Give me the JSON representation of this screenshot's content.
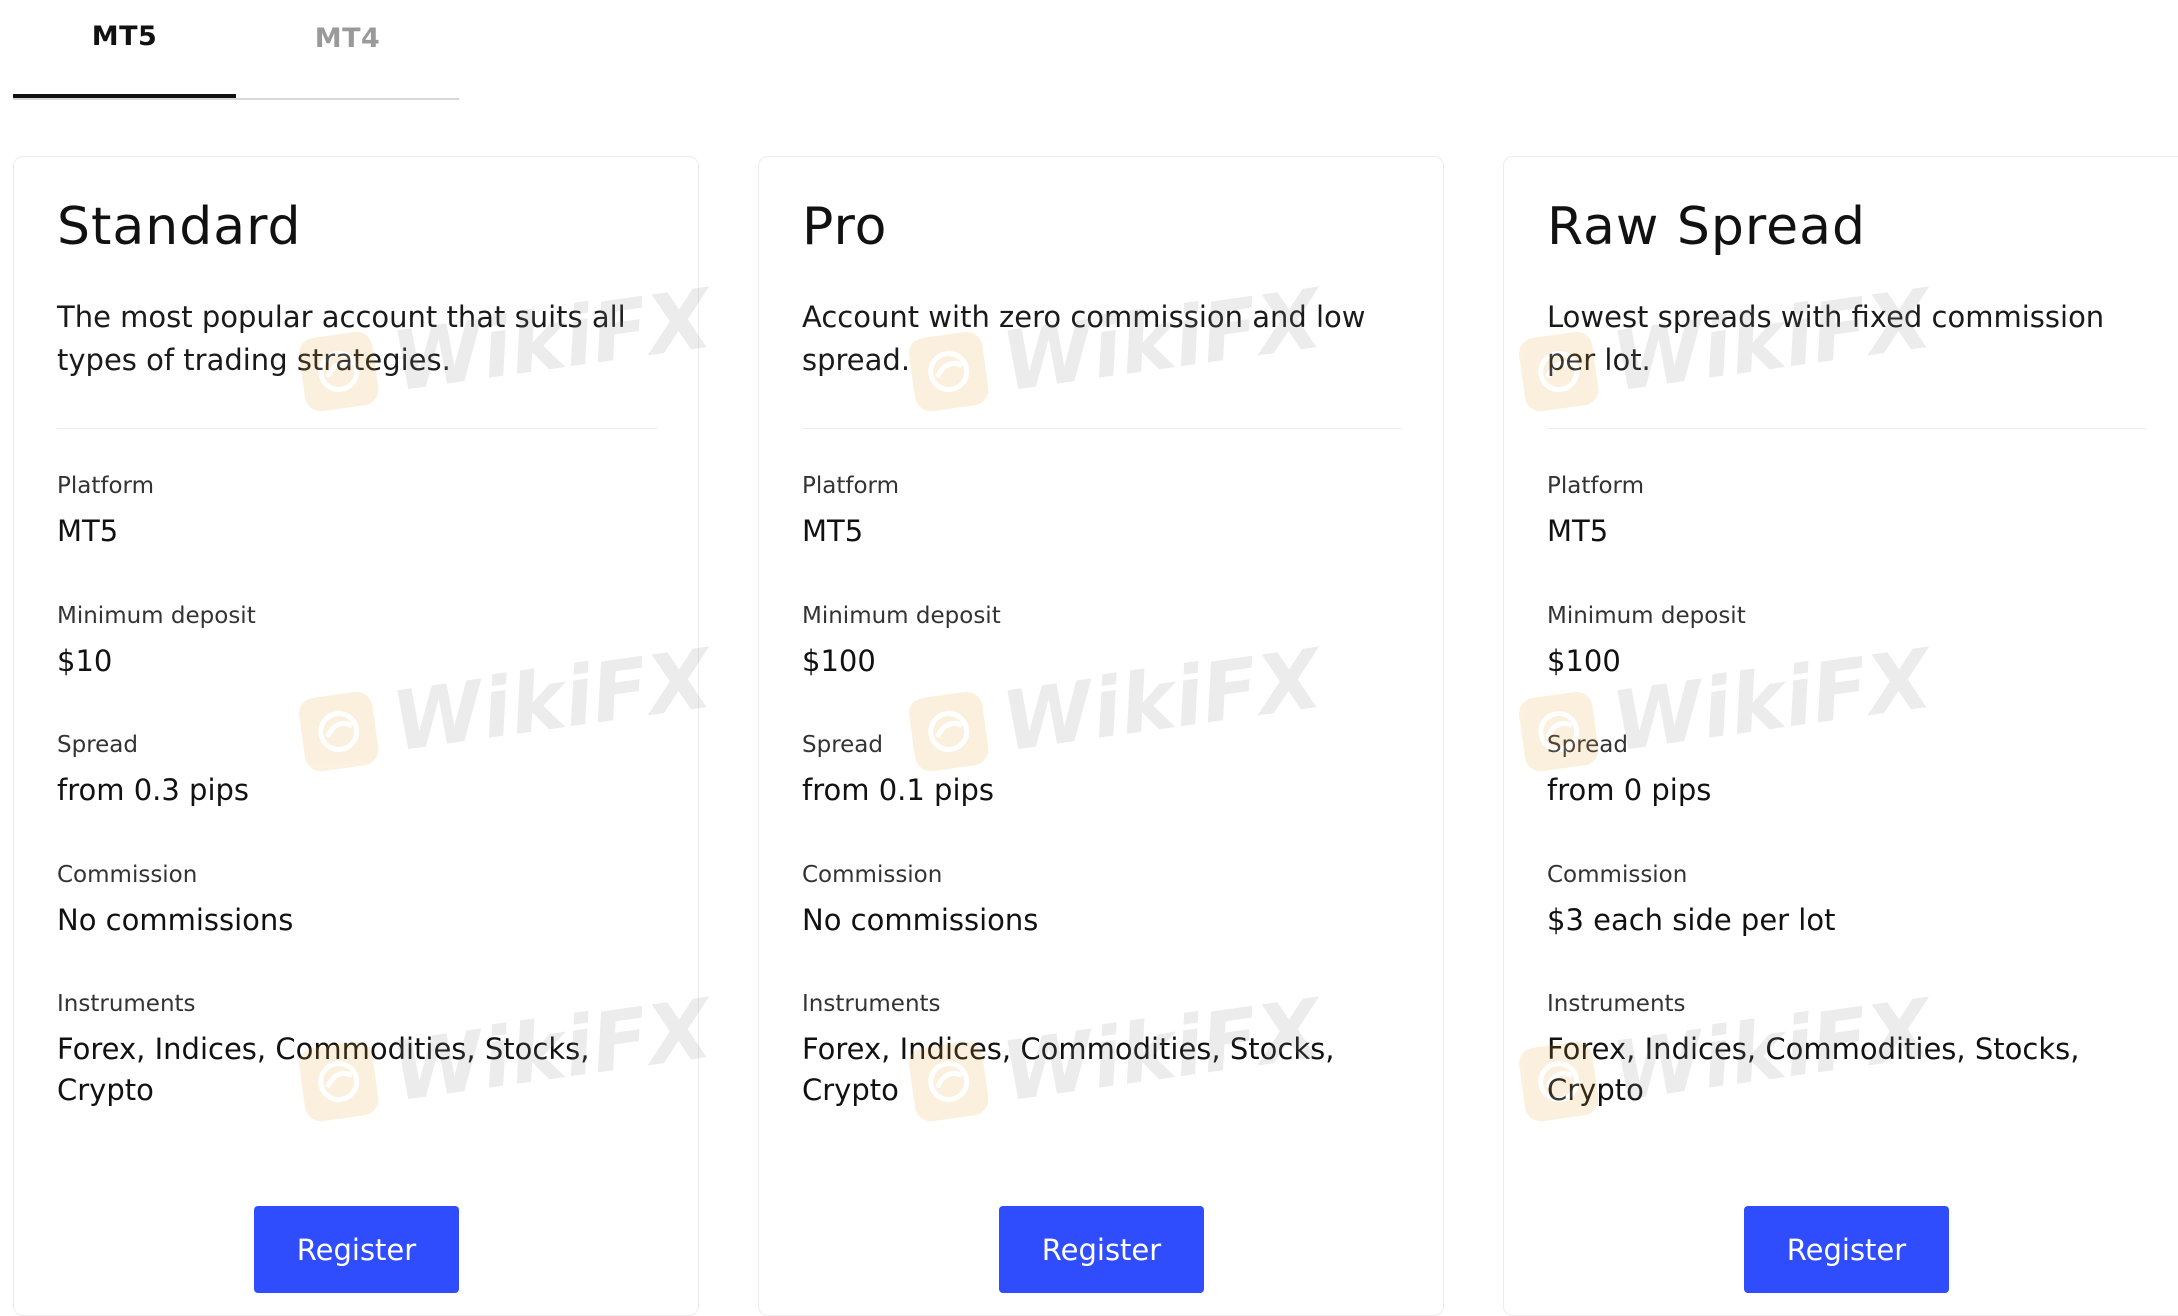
{
  "tabs": [
    {
      "label": "MT5",
      "active": true
    },
    {
      "label": "MT4",
      "active": false
    }
  ],
  "watermark_text": "WikiFX",
  "colors": {
    "accent": "#2f4dfc",
    "watermark_logo": "#e7a634"
  },
  "icons": {
    "watermark_logo": "wikifx-logo-icon"
  },
  "labels": {
    "platform": "Platform",
    "min_deposit": "Minimum deposit",
    "spread": "Spread",
    "commission": "Commission",
    "instruments": "Instruments"
  },
  "cards": [
    {
      "title": "Standard",
      "description": "The most popular account that suits all types of trading strategies.",
      "platform": "MT5",
      "min_deposit": "$10",
      "spread": "from 0.3 pips",
      "commission": "No commissions",
      "instruments": "Forex, Indices, Commodities, Stocks, Crypto",
      "button": "Register"
    },
    {
      "title": "Pro",
      "description": "Account with zero commission and low spread.",
      "platform": "MT5",
      "min_deposit": "$100",
      "spread": "from 0.1 pips",
      "commission": "No commissions",
      "instruments": "Forex, Indices, Commodities, Stocks, Crypto",
      "button": "Register"
    },
    {
      "title": "Raw Spread",
      "description": "Lowest spreads with fixed commission per lot.",
      "platform": "MT5",
      "min_deposit": "$100",
      "spread": "from 0 pips",
      "commission": "$3 each side per lot",
      "instruments": "Forex, Indices, Commodities, Stocks, Crypto",
      "button": "Register"
    }
  ]
}
